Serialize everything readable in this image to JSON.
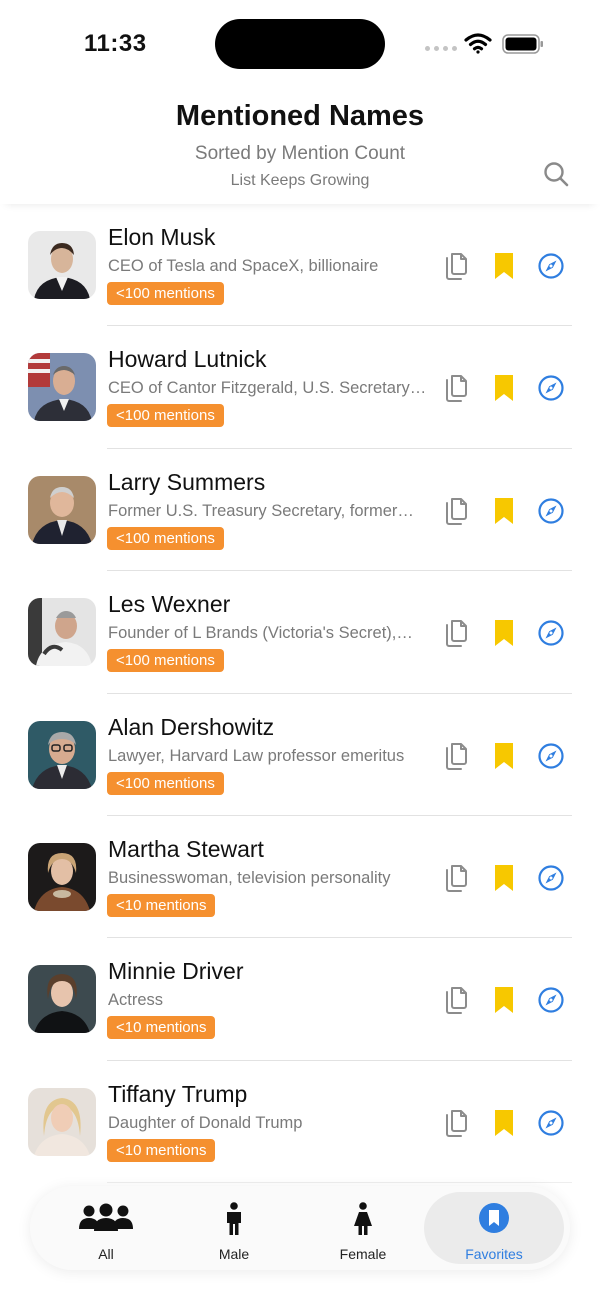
{
  "status": {
    "time": "11:33"
  },
  "header": {
    "title": "Mentioned Names",
    "subtitle": "Sorted by Mention Count",
    "note": "List Keeps Growing"
  },
  "people": [
    {
      "name": "Elon Musk",
      "desc": "CEO of Tesla and SpaceX, billionaire",
      "badge": "<100 mentions"
    },
    {
      "name": "Howard Lutnick",
      "desc": "CEO of Cantor Fitzgerald, U.S. Secretary…",
      "badge": "<100 mentions"
    },
    {
      "name": "Larry Summers",
      "desc": "Former U.S. Treasury Secretary, former…",
      "badge": "<100 mentions"
    },
    {
      "name": "Les Wexner",
      "desc": "Founder of L Brands (Victoria's Secret),…",
      "badge": "<100 mentions"
    },
    {
      "name": "Alan Dershowitz",
      "desc": "Lawyer, Harvard Law professor emeritus",
      "badge": "<100 mentions"
    },
    {
      "name": "Martha Stewart",
      "desc": "Businesswoman, television personality",
      "badge": "<10 mentions"
    },
    {
      "name": "Minnie Driver",
      "desc": "Actress",
      "badge": "<10 mentions"
    },
    {
      "name": "Tiffany Trump",
      "desc": "Daughter of Donald Trump",
      "badge": "<10 mentions"
    }
  ],
  "tabs": [
    {
      "label": "All",
      "icon": "group-icon"
    },
    {
      "label": "Male",
      "icon": "male-icon"
    },
    {
      "label": "Female",
      "icon": "female-icon"
    },
    {
      "label": "Favorites",
      "icon": "bookmark-circle-icon",
      "active": true
    }
  ],
  "colors": {
    "accent": "#2f7ee0",
    "badge": "#f5902f",
    "bookmark": "#f7c800"
  }
}
